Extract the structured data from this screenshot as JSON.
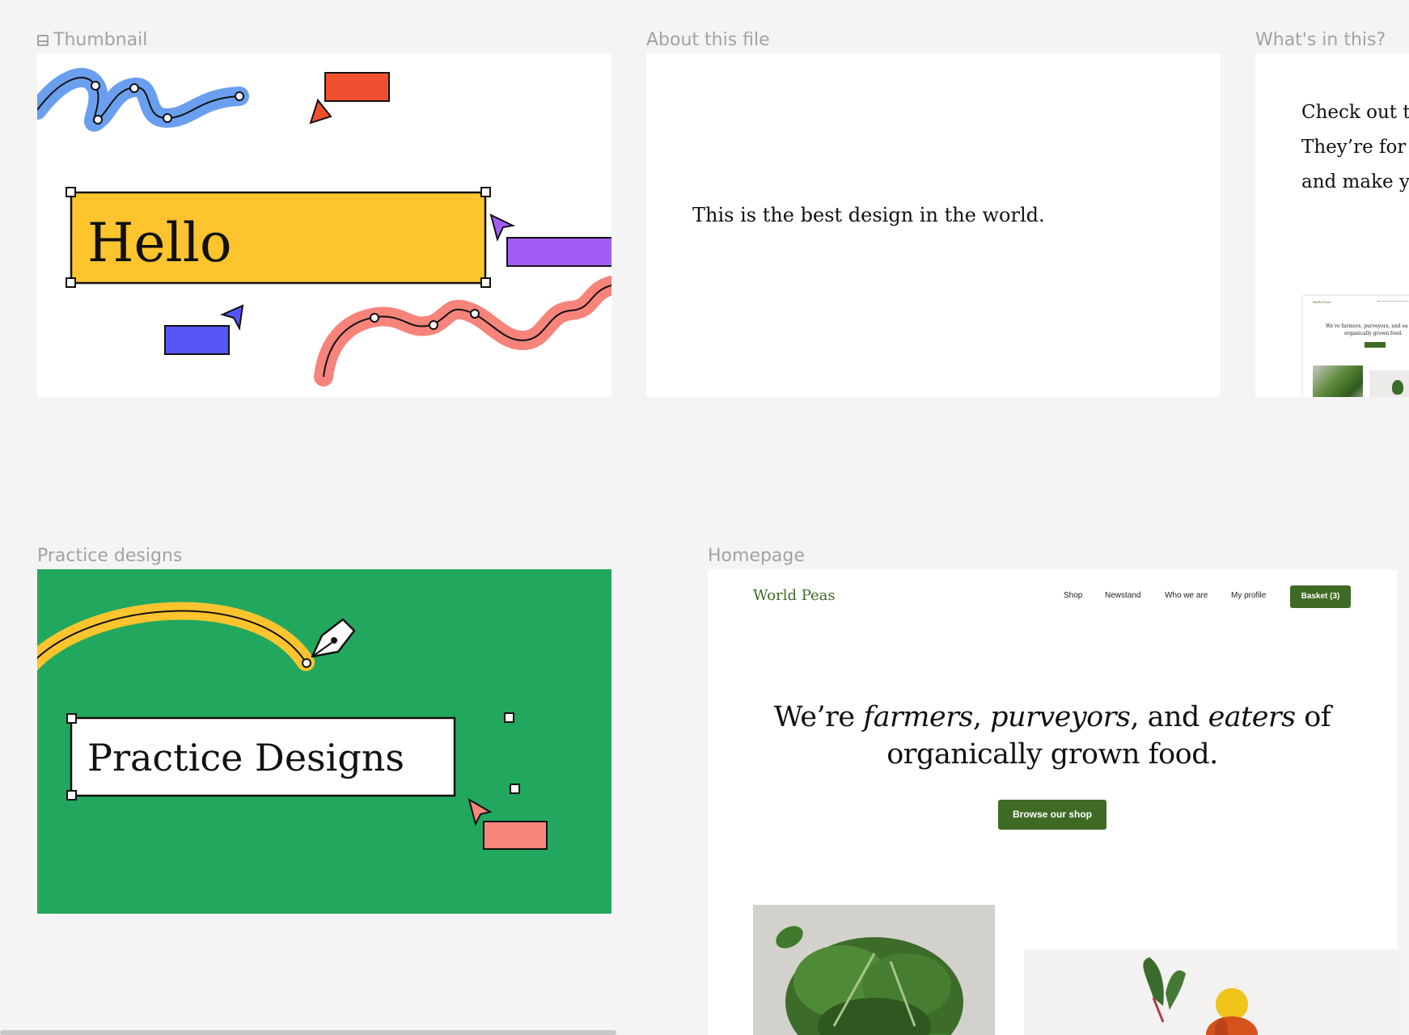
{
  "frames": {
    "thumbnail": {
      "label": "Thumbnail",
      "hello_text": "Hello"
    },
    "about": {
      "label": "About this file",
      "text": "This is the best design in the world."
    },
    "whats_in": {
      "label": "What's in this?",
      "lines": [
        "Check out th",
        "They’re for y",
        "and make yo"
      ],
      "mini": {
        "brand": "World Peas",
        "headline_line1": "We’re farmers, purveyors, and ea",
        "headline_line2": "organically grown food."
      }
    },
    "practice": {
      "label": "Practice designs",
      "text": "Practice Designs"
    },
    "homepage": {
      "label": "Homepage",
      "brand": "World Peas",
      "nav": [
        "Shop",
        "Newstand",
        "Who we are",
        "My profile"
      ],
      "basket": "Basket (3)",
      "headline": {
        "line1_a": "We’re ",
        "line1_b": "farmers",
        "line1_c": ", ",
        "line1_d": "purveyors",
        "line1_e": ", and ",
        "line1_f": "eaters",
        "line1_g": " of",
        "line2": "organically grown food."
      },
      "cta": "Browse our shop"
    }
  },
  "colors": {
    "canvas": "#f4f4f4",
    "yellow": "#fec42e",
    "green_bg": "#22a75e",
    "brand_green": "#3f6a24",
    "blue_squiggle": "#6a9ff0",
    "red_squiggle": "#f7847a",
    "red_rect": "#f15030",
    "purple_rect": "#a45cf7",
    "blue_rect": "#5656f7",
    "salmon_rect": "#f9867b"
  }
}
